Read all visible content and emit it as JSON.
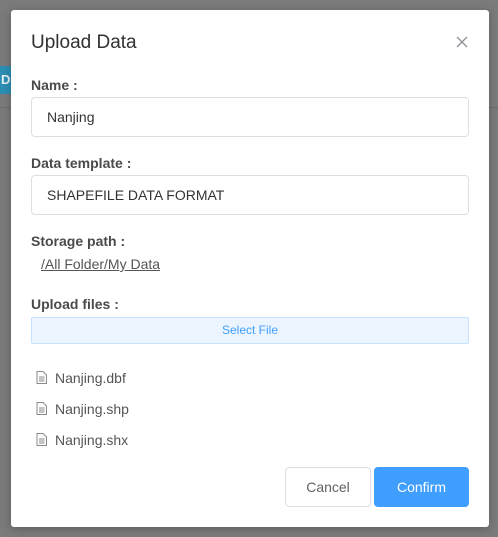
{
  "background": {
    "fragment_text": "D"
  },
  "dialog": {
    "title": "Upload Data",
    "close_icon": "close-icon",
    "name": {
      "label": "Name :",
      "value": "Nanjing"
    },
    "template": {
      "label": "Data template :",
      "value": "SHAPEFILE DATA FORMAT"
    },
    "storage": {
      "label": "Storage path :",
      "path": "/All Folder/My Data"
    },
    "upload": {
      "label": "Upload files :",
      "select_label": "Select File",
      "files": [
        {
          "name": "Nanjing.dbf",
          "icon": "file-icon"
        },
        {
          "name": "Nanjing.shp",
          "icon": "file-icon"
        },
        {
          "name": "Nanjing.shx",
          "icon": "file-icon"
        }
      ]
    },
    "cancel_label": "Cancel",
    "confirm_label": "Confirm"
  },
  "colors": {
    "primary": "#409eff",
    "overlay": "#7b7b7b",
    "select_bg": "#ecf5ff"
  }
}
